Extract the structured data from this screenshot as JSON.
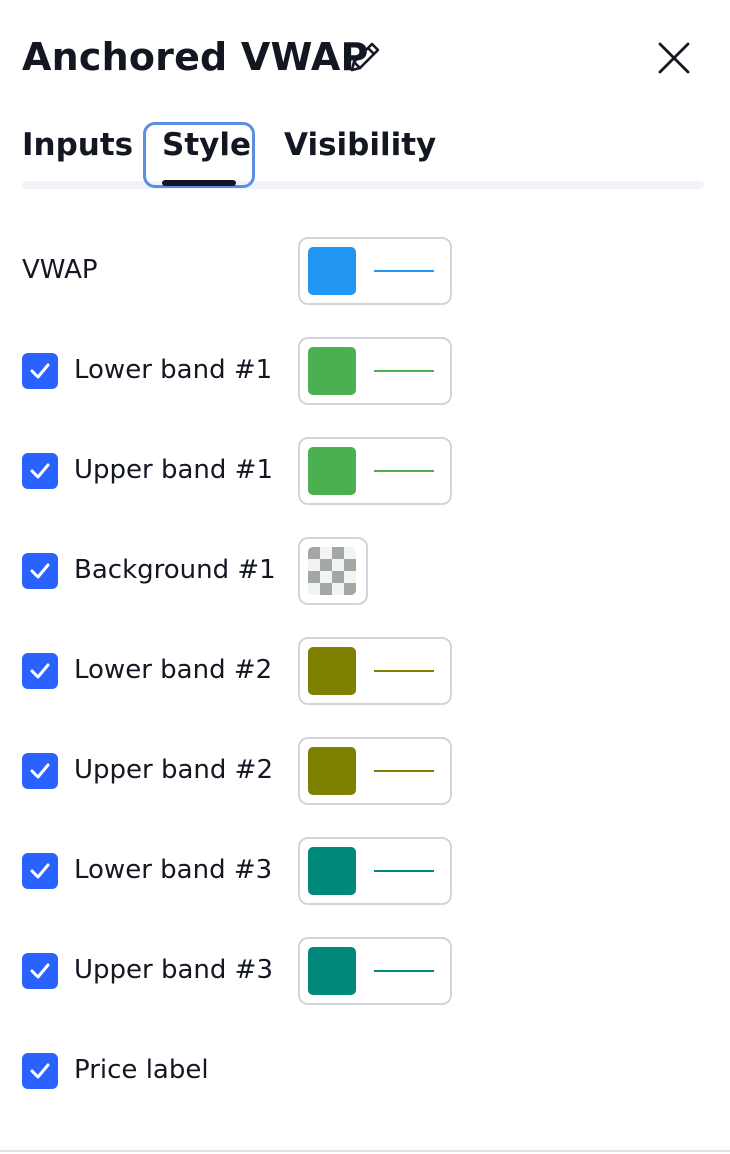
{
  "dialog": {
    "title": "Anchored VWAP",
    "edit_icon": "pencil-icon",
    "close_icon": "close-icon"
  },
  "tabs": [
    {
      "label": "Inputs",
      "active": false
    },
    {
      "label": "Style",
      "active": true
    },
    {
      "label": "Visibility",
      "active": false
    }
  ],
  "style_rows": [
    {
      "label": "VWAP",
      "checkbox": false,
      "color": "#2196F3",
      "line": true
    },
    {
      "label": "Lower band #1",
      "checkbox": true,
      "checked": true,
      "color": "#4CAF50",
      "line": true
    },
    {
      "label": "Upper band #1",
      "checkbox": true,
      "checked": true,
      "color": "#4CAF50",
      "line": true
    },
    {
      "label": "Background #1",
      "checkbox": true,
      "checked": true,
      "color": "transparent-checker",
      "line": false
    },
    {
      "label": "Lower band #2",
      "checkbox": true,
      "checked": true,
      "color": "#808000",
      "line": true
    },
    {
      "label": "Upper band #2",
      "checkbox": true,
      "checked": true,
      "color": "#808000",
      "line": true
    },
    {
      "label": "Lower band #3",
      "checkbox": true,
      "checked": true,
      "color": "#00897B",
      "line": true
    },
    {
      "label": "Upper band #3",
      "checkbox": true,
      "checked": true,
      "color": "#00897B",
      "line": true
    },
    {
      "label": "Price label",
      "checkbox": true,
      "checked": true
    }
  ],
  "colors": {
    "accent": "#2962FF",
    "text": "#131722",
    "focus_ring": "#5A8EE0",
    "border": "#D1D4DC",
    "tab_track": "#F0F3FA"
  }
}
